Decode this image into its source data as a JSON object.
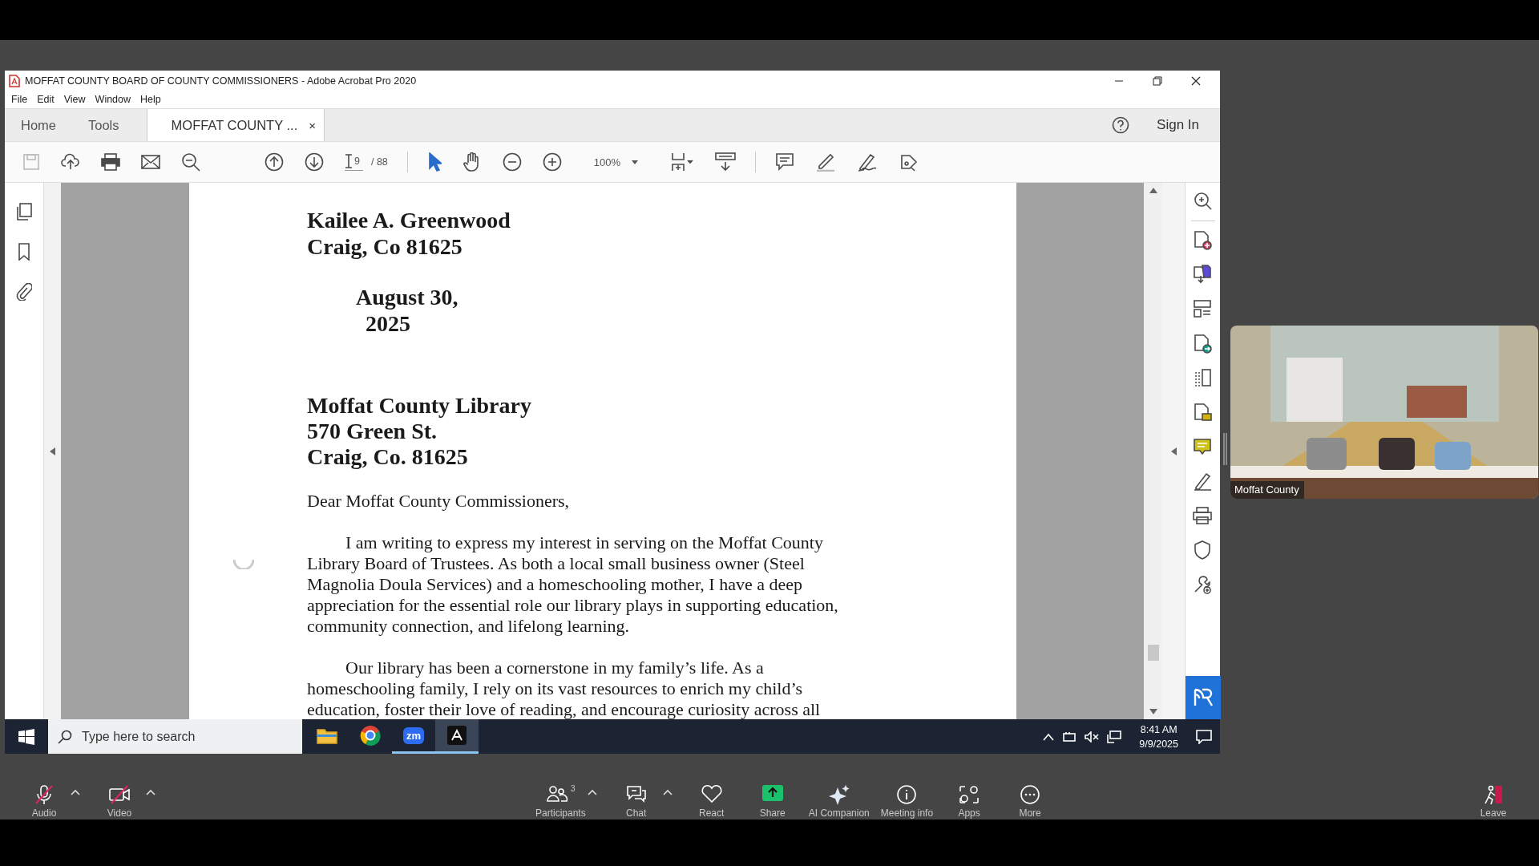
{
  "acrobat": {
    "title": "MOFFAT COUNTY BOARD OF COUNTY COMMISSIONERS  - Adobe Acrobat Pro 2020",
    "menu": [
      "File",
      "Edit",
      "View",
      "Window",
      "Help"
    ],
    "tabs": [
      {
        "label": "Home",
        "selected": false
      },
      {
        "label": "Tools",
        "selected": false
      },
      {
        "label": "MOFFAT COUNTY ...",
        "selected": true,
        "close": "×"
      }
    ],
    "sign_in": "Sign In",
    "page_number": "9",
    "page_count": "/ 88",
    "zoom_level": "100%"
  },
  "letter": {
    "sender": [
      "Kailee A. Greenwood",
      "Craig, Co 81625"
    ],
    "date": [
      "August 30,",
      "2025"
    ],
    "recipient": [
      "Moffat County Library",
      "570 Green St.",
      "Craig, Co. 81625"
    ],
    "salutation": "Dear Moffat County Commissioners,",
    "paragraphs": [
      [
        "I am writing to express my interest in serving on the Moffat County",
        "Library Board of Trustees. As both a local small business owner (Steel",
        "Magnolia Doula Services) and a homeschooling mother, I have a deep",
        "appreciation for the essential role our library plays in supporting education,",
        "community connection, and lifelong learning."
      ],
      [
        "Our library has been a cornerstone in my family’s life. As a",
        "homeschooling family, I rely on its vast resources to enrich my child’s",
        "education, foster their love of reading, and encourage curiosity across all"
      ]
    ]
  },
  "taskbar": {
    "search_placeholder": "Type here to search",
    "apps": [
      {
        "kind": "explorer",
        "running": false,
        "active": false
      },
      {
        "kind": "chrome",
        "running": false,
        "active": false
      },
      {
        "kind": "zoom",
        "label": "zm",
        "running": true,
        "active": false
      },
      {
        "kind": "acrobat",
        "running": true,
        "active": true
      }
    ],
    "time": "8:41 AM",
    "date": "9/9/2025"
  },
  "video_tile": {
    "name": "Moffat County"
  },
  "meeting_controls": {
    "left": [
      {
        "kind": "audio",
        "label": "Audio",
        "muted": true,
        "menu": true
      },
      {
        "kind": "video",
        "label": "Video",
        "muted": true,
        "menu": true
      }
    ],
    "center": [
      {
        "kind": "participants",
        "label": "Participants",
        "count": "3",
        "menu": true
      },
      {
        "kind": "chat",
        "label": "Chat",
        "menu": true
      },
      {
        "kind": "react",
        "label": "React",
        "menu": false
      },
      {
        "kind": "share",
        "label": "Share",
        "menu": false
      },
      {
        "kind": "ai",
        "label": "AI Companion",
        "menu": false
      },
      {
        "kind": "info",
        "label": "Meeting info",
        "menu": false
      },
      {
        "kind": "apps",
        "label": "Apps",
        "menu": false
      },
      {
        "kind": "more",
        "label": "More",
        "menu": false
      }
    ],
    "right": [
      {
        "kind": "leave",
        "label": "Leave",
        "menu": false
      }
    ]
  }
}
